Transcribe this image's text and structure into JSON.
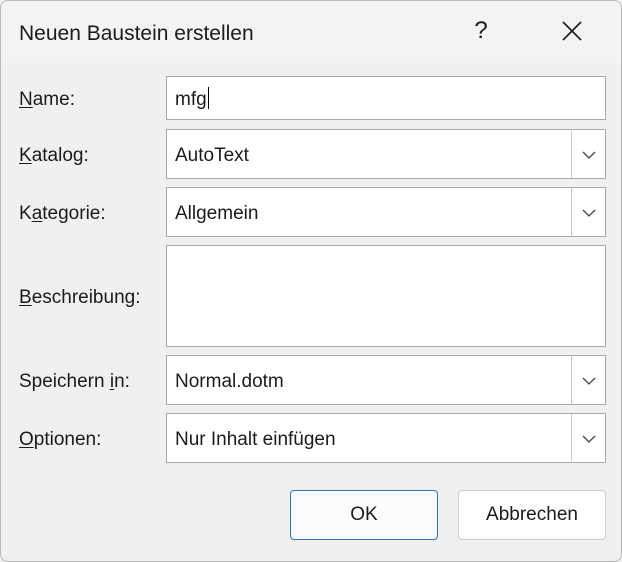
{
  "dialog": {
    "title": "Neuen Baustein erstellen",
    "help_glyph": "?",
    "close_icon": "close-icon"
  },
  "form": {
    "name": {
      "label_key": "N",
      "label_rest": "ame:",
      "value": "mfg"
    },
    "katalog": {
      "label_key": "K",
      "label_rest": "atalog:",
      "value": "AutoText"
    },
    "kategorie": {
      "label_pre": "K",
      "label_key": "a",
      "label_rest": "tegorie:",
      "value": "Allgemein"
    },
    "beschreibung": {
      "label_key": "B",
      "label_rest": "eschreibung:",
      "value": ""
    },
    "speichern": {
      "label_pre": "Speichern ",
      "label_key": "i",
      "label_rest": "n:",
      "value": "Normal.dotm"
    },
    "optionen": {
      "label_key": "O",
      "label_rest": "ptionen:",
      "value": "Nur Inhalt einfügen"
    }
  },
  "buttons": {
    "ok": "OK",
    "cancel": "Abbrechen"
  },
  "colors": {
    "ok_border": "#2f6fb3",
    "dialog_bg": "#f0f0f0"
  }
}
